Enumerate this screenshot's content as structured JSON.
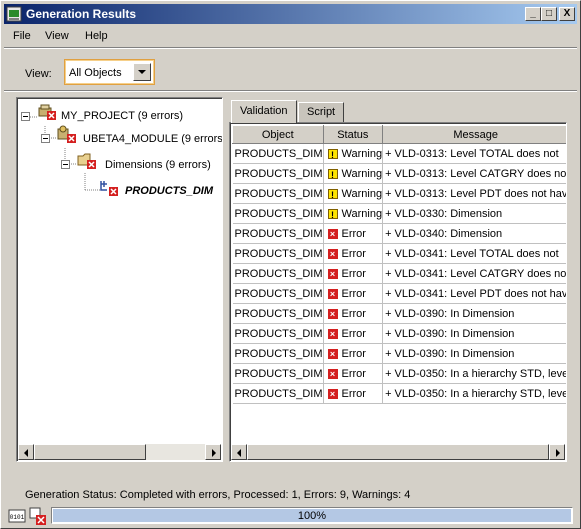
{
  "window": {
    "title": "Generation Results",
    "controls": [
      "_",
      "□",
      "X"
    ]
  },
  "menu": [
    "File",
    "View",
    "Help"
  ],
  "view": {
    "label": "View:",
    "selected": "All Objects"
  },
  "tree": {
    "nodes": [
      {
        "label": "MY_PROJECT (9 errors)",
        "icon": "project-icon",
        "expandable": true
      },
      {
        "label": "UBETA4_MODULE (9 errors)",
        "icon": "module-icon",
        "expandable": true
      },
      {
        "label": "Dimensions (9 errors)",
        "icon": "folder-icon",
        "expandable": true
      },
      {
        "label": "PRODUCTS_DIM",
        "icon": "dimension-icon",
        "expandable": false
      }
    ]
  },
  "tabs": [
    {
      "label": "Validation",
      "active": true
    },
    {
      "label": "Script",
      "active": false
    }
  ],
  "table": {
    "columns": [
      "Object",
      "Status",
      "Message"
    ],
    "rows": [
      {
        "object": "PRODUCTS_DIM",
        "status": "Warning",
        "message": "+  VLD-0313: Level TOTAL does not"
      },
      {
        "object": "PRODUCTS_DIM",
        "status": "Warning",
        "message": "+  VLD-0313: Level CATGRY does no"
      },
      {
        "object": "PRODUCTS_DIM",
        "status": "Warning",
        "message": "+  VLD-0313: Level PDT does not hav"
      },
      {
        "object": "PRODUCTS_DIM",
        "status": "Warning",
        "message": "+  VLD-0330: Dimension"
      },
      {
        "object": "PRODUCTS_DIM",
        "status": "Error",
        "message": "+  VLD-0340: Dimension"
      },
      {
        "object": "PRODUCTS_DIM",
        "status": "Error",
        "message": "+  VLD-0341: Level TOTAL does not"
      },
      {
        "object": "PRODUCTS_DIM",
        "status": "Error",
        "message": "+  VLD-0341: Level CATGRY does no"
      },
      {
        "object": "PRODUCTS_DIM",
        "status": "Error",
        "message": "+  VLD-0341: Level PDT does not hav"
      },
      {
        "object": "PRODUCTS_DIM",
        "status": "Error",
        "message": "+  VLD-0390: In Dimension"
      },
      {
        "object": "PRODUCTS_DIM",
        "status": "Error",
        "message": "+  VLD-0390: In Dimension"
      },
      {
        "object": "PRODUCTS_DIM",
        "status": "Error",
        "message": "+  VLD-0390: In Dimension"
      },
      {
        "object": "PRODUCTS_DIM",
        "status": "Error",
        "message": "+  VLD-0350: In a hierarchy STD, leve"
      },
      {
        "object": "PRODUCTS_DIM",
        "status": "Error",
        "message": "+  VLD-0350: In a hierarchy STD, leve"
      }
    ]
  },
  "status": {
    "text": "Generation Status: Completed with errors, Processed: 1, Errors: 9, Warnings: 4"
  },
  "progress": {
    "value": 1.0,
    "label": "100%"
  },
  "colors": {
    "title_start": "#0a246a",
    "title_end": "#a6caf0",
    "window_bg": "#d4d0c8",
    "progress_fill": "#b4c8e4",
    "error": "#d42020",
    "warning": "#ffe400"
  }
}
